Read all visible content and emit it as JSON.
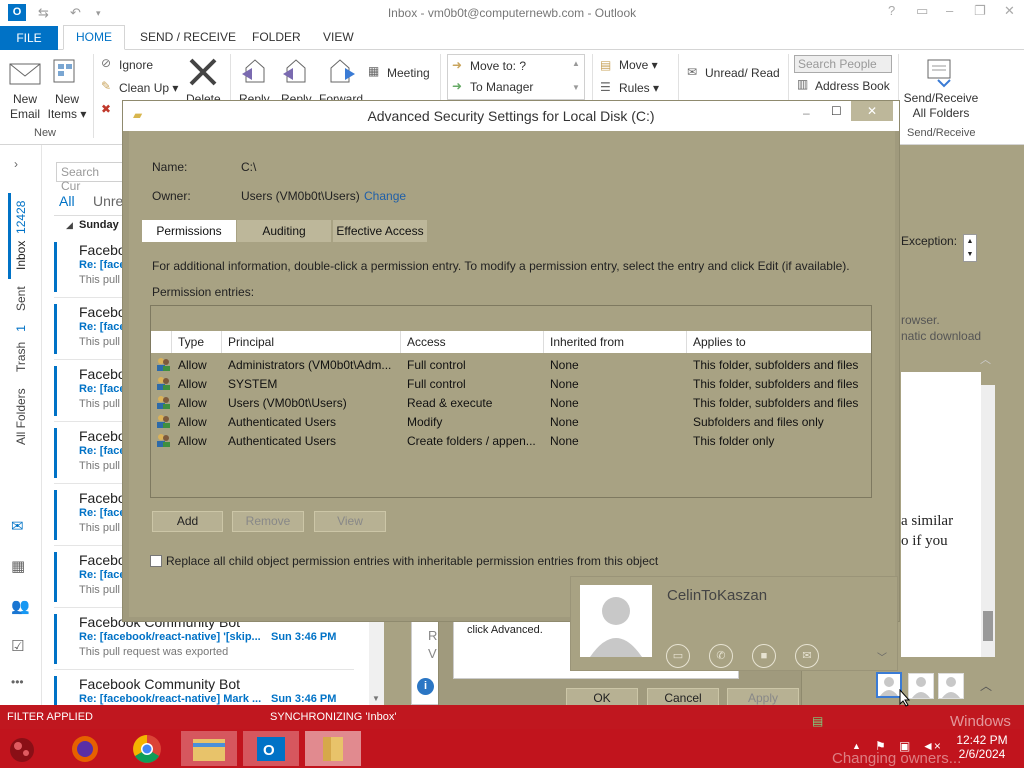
{
  "window": {
    "title": "Inbox - vm0b0t@computernewb.com - Outlook",
    "app_icon": "O"
  },
  "tabs": [
    "FILE",
    "HOME",
    "SEND / RECEIVE",
    "FOLDER",
    "VIEW"
  ],
  "ribbon": {
    "new_email": "New Email",
    "new_email_l1": "New",
    "new_email_l2": "Email",
    "new_items_l1": "New",
    "new_items_l2": "Items",
    "group_new": "New",
    "ignore": "Ignore",
    "clean_up": "Clean Up",
    "delete": "Delete",
    "reply": "Reply",
    "reply_all": "Reply",
    "forward": "Forward",
    "meeting": "Meeting",
    "move_to": "Move to: ?",
    "to_manager": "To Manager",
    "move": "Move",
    "rules": "Rules",
    "unread_read": "Unread/ Read",
    "search_people": "Search People",
    "address_book": "Address Book",
    "send_receive_l1": "Send/Receive",
    "send_receive_l2": "All Folders",
    "group_send_receive": "Send/Receive"
  },
  "nav": {
    "inbox": "Inbox",
    "inbox_count": "12428",
    "sent": "Sent",
    "trash": "Trash",
    "trash_count": "1",
    "all_folders": "All Folders"
  },
  "list": {
    "search_placeholder": "Search Cur",
    "filter_all": "All",
    "filter_unread": "Unre",
    "group_header": "Sunday",
    "items": [
      {
        "from": "Faceboo",
        "subject": "Re: [face",
        "preview": "This pull",
        "time": ""
      },
      {
        "from": "Faceboo",
        "subject": "Re: [face",
        "preview": "This pull",
        "time": ""
      },
      {
        "from": "Faceboo",
        "subject": "Re: [face",
        "preview": "This pull",
        "time": ""
      },
      {
        "from": "Faceboo",
        "subject": "Re: [face",
        "preview": "This pull",
        "time": ""
      },
      {
        "from": "Faceboo",
        "subject": "Re: [face",
        "preview": "This pull",
        "time": ""
      },
      {
        "from": "Faceboo",
        "subject": "Re: [face",
        "preview": "This pull",
        "time": ""
      },
      {
        "from": "Facebook Community Bot",
        "subject": "Re: [facebook/react-native] '[skip...",
        "preview": "This pull request was exported",
        "time": "Sun 3:46 PM"
      },
      {
        "from": "Facebook Community Bot",
        "subject": "Re: [facebook/react-native] Mark ...",
        "preview": "",
        "time": "Sun 3:46 PM"
      }
    ]
  },
  "reading": {
    "exception": "Exception:",
    "text1": "rowser.",
    "text2": "natic download",
    "text3": "a similar",
    "text4": "o if you",
    "partial_r": "R",
    "partial_v": "V"
  },
  "dialog": {
    "title": "Advanced Security Settings for Local Disk (C:)",
    "name_label": "Name:",
    "name_value": "C:\\",
    "owner_label": "Owner:",
    "owner_value": "Users (VM0b0t\\Users)",
    "change_link": "Change",
    "tabs": [
      "Permissions",
      "Auditing",
      "Effective Access"
    ],
    "info": "For additional information, double-click a permission entry. To modify a permission entry, select the entry and click Edit (if available).",
    "entries_label": "Permission entries:",
    "columns": [
      "Type",
      "Principal",
      "Access",
      "Inherited from",
      "Applies to"
    ],
    "rows": [
      [
        "Allow",
        "Administrators (VM0b0t\\Adm...",
        "Full control",
        "None",
        "This folder, subfolders and files"
      ],
      [
        "Allow",
        "SYSTEM",
        "Full control",
        "None",
        "This folder, subfolders and files"
      ],
      [
        "Allow",
        "Users (VM0b0t\\Users)",
        "Read & execute",
        "None",
        "This folder, subfolders and files"
      ],
      [
        "Allow",
        "Authenticated Users",
        "Modify",
        "None",
        "Subfolders and files only"
      ],
      [
        "Allow",
        "Authenticated Users",
        "Create folders / appen...",
        "None",
        "This folder only"
      ]
    ],
    "add": "Add",
    "remove": "Remove",
    "view": "View",
    "replace_checkbox": "Replace all child object permission entries with inheritable permission entries from this object"
  },
  "dialog2": {
    "text": "click Advanced.",
    "ok": "OK",
    "cancel": "Cancel",
    "apply": "Apply"
  },
  "card": {
    "name": "CelinToKaszan"
  },
  "status": {
    "filter": "FILTER APPLIED",
    "sync": "SYNCHRONIZING 'Inbox'"
  },
  "taskbar": {
    "time": "12:42 PM",
    "date": "2/6/2024",
    "watermark1": "Windows",
    "watermark2": "Changing owners..."
  },
  "colors": {
    "accent": "#0072c6",
    "dialog_bg": "#a8a283",
    "taskbar": "#c1141d"
  }
}
